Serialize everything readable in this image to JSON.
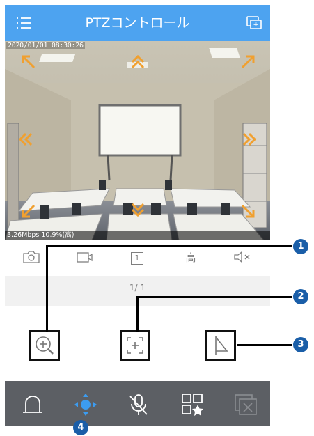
{
  "header": {
    "title": "PTZコントロール",
    "menu_icon": "hamburger-menu-icon",
    "screen_icon": "screen-switch-icon"
  },
  "video": {
    "timestamp": "2020/01/01 08:30:26",
    "bitrate": "3.26Mbps 10.9%(高)",
    "ptz_arrows": [
      "up",
      "down",
      "left",
      "right",
      "up-left",
      "up-right",
      "down-left",
      "down-right"
    ]
  },
  "toolbar": {
    "snapshot_icon": "camera-icon",
    "record_icon": "video-record-icon",
    "split_label": "1",
    "quality_label": "高",
    "mute_icon": "speaker-mute-icon"
  },
  "page_indicator": "1/ 1",
  "controls": {
    "zoom_icon": "zoom-in-icon",
    "focus_icon": "focus-frame-icon",
    "preset_icon": "flag-icon"
  },
  "bottom_nav": [
    {
      "icon": "alarm-light-icon",
      "active": false
    },
    {
      "icon": "ptz-direction-icon",
      "active": true
    },
    {
      "icon": "microphone-off-icon",
      "active": false
    },
    {
      "icon": "favorites-grid-icon",
      "active": false
    },
    {
      "icon": "close-window-icon",
      "active": false
    }
  ],
  "callouts": [
    "1",
    "2",
    "3",
    "4"
  ],
  "colors": {
    "accent": "#4da3f0",
    "nav_bg": "#5c5f64",
    "callout": "#1a5ea8",
    "ptz_arrow": "#f0a030"
  }
}
